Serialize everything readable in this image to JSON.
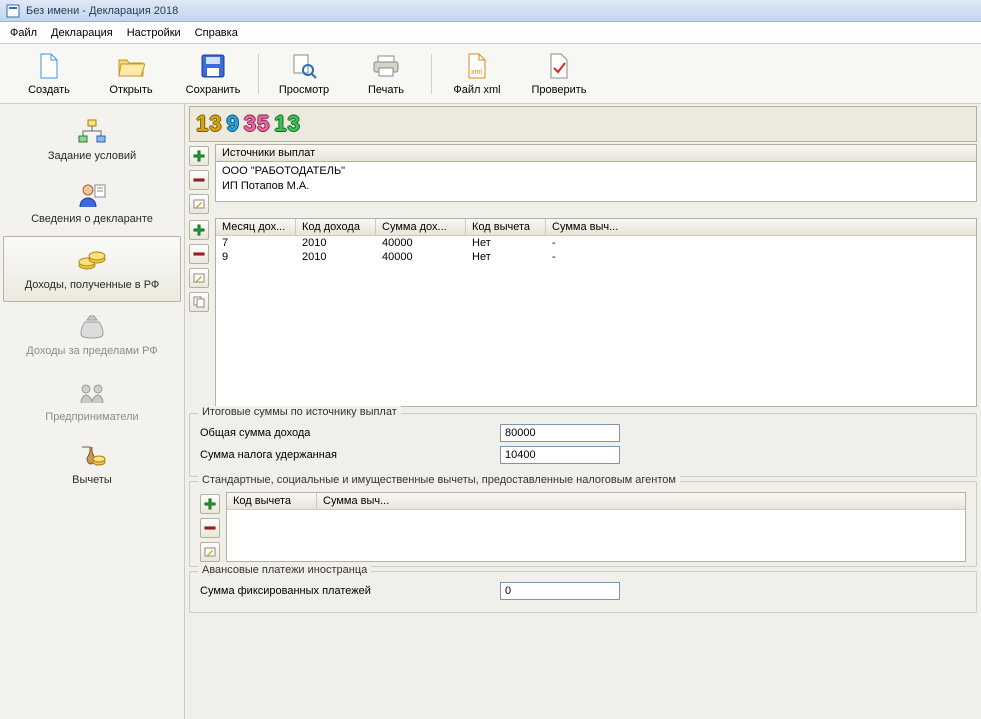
{
  "titlebar": {
    "title": "Без имени - Декларация 2018"
  },
  "menubar": {
    "file": "Файл",
    "decl": "Декларация",
    "settings": "Настройки",
    "help": "Справка"
  },
  "toolbar": {
    "create": "Создать",
    "open": "Открыть",
    "save": "Сохранить",
    "preview": "Просмотр",
    "print": "Печать",
    "xml": "Файл xml",
    "check": "Проверить"
  },
  "sidenav": {
    "conditions": "Задание условий",
    "declarant": "Сведения о декларанте",
    "income_rf": "Доходы, полученные в РФ",
    "income_foreign": "Доходы за пределами РФ",
    "entrepreneurs": "Предприниматели",
    "deductions": "Вычеты"
  },
  "digits": {
    "d1": "13",
    "d2": "9",
    "d3": "35",
    "d4": "13"
  },
  "sources": {
    "header": "Источники выплат",
    "items": [
      {
        "name": "ООО \"РАБОТОДАТЕЛЬ\""
      },
      {
        "name": "ИП Потапов М.А."
      }
    ]
  },
  "income_table": {
    "headers": {
      "month": "Месяц дох...",
      "code": "Код дохода",
      "sum": "Сумма дох...",
      "dedcode": "Код вычета",
      "dedsum": "Сумма выч..."
    },
    "rows": [
      {
        "month": "7",
        "code": "2010",
        "sum": "40000",
        "dedcode": "Нет",
        "dedsum": "-"
      },
      {
        "month": "9",
        "code": "2010",
        "sum": "40000",
        "dedcode": "Нет",
        "dedsum": "-"
      }
    ]
  },
  "totals": {
    "legend": "Итоговые суммы по источнику выплат",
    "total_income_label": "Общая сумма дохода",
    "total_income_value": "80000",
    "tax_withheld_label": "Сумма налога удержанная",
    "tax_withheld_value": "10400"
  },
  "agent_deductions": {
    "legend": "Стандартные, социальные и имущественные вычеты, предоставленные налоговым агентом",
    "headers": {
      "code": "Код вычета",
      "sum": "Сумма выч..."
    }
  },
  "advance": {
    "legend": "Авансовые платежи иностранца",
    "label": "Сумма фиксированных платежей",
    "value": "0"
  }
}
